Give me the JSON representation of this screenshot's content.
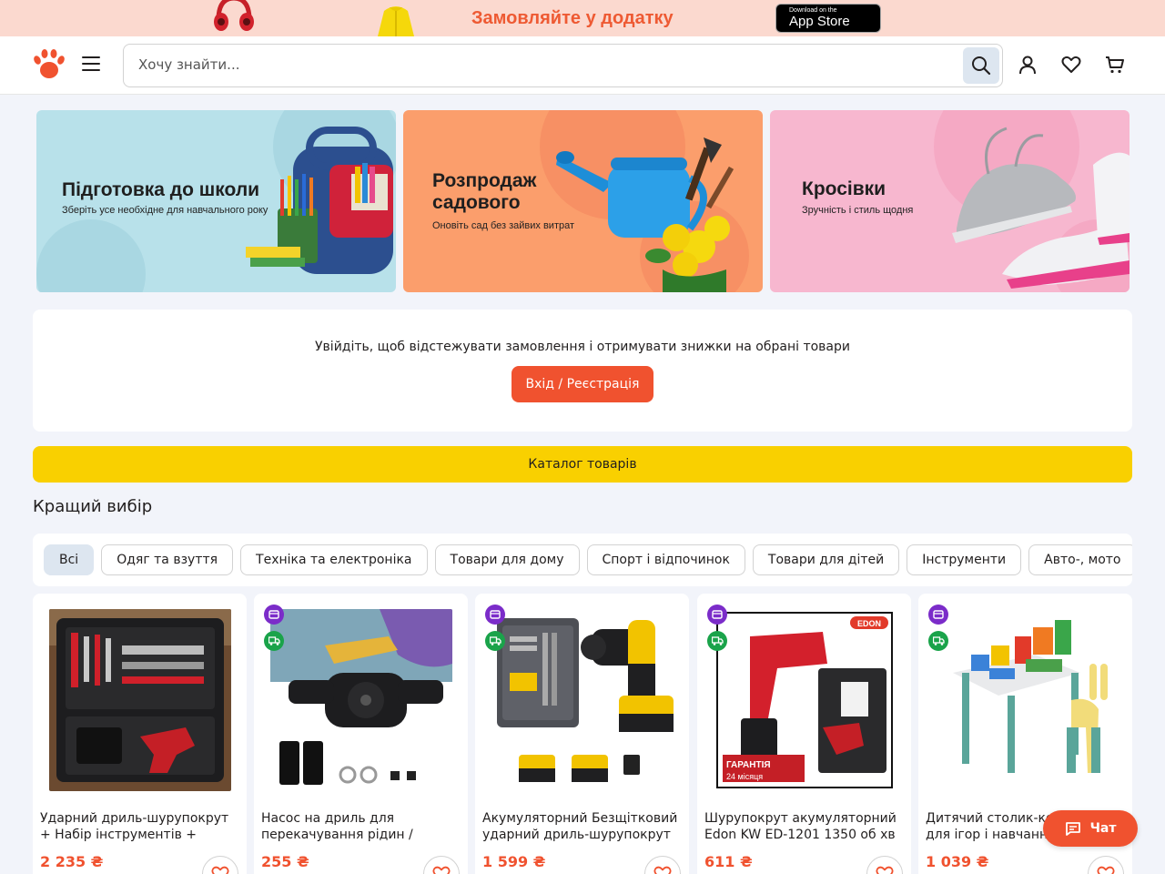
{
  "promo": {
    "text": "Замовляйте у додатку",
    "appstore_small": "Download on the",
    "appstore_big": "App Store"
  },
  "header": {
    "search_placeholder": "Хочу знайти...",
    "icons": [
      "logo-paw-icon",
      "menu-icon",
      "search-icon",
      "user-icon",
      "heart-icon",
      "cart-icon"
    ]
  },
  "banners": [
    {
      "title": "Підготовка до школи",
      "subtitle": "Зберіть усе необхідне для навчального року"
    },
    {
      "title": "Розпродаж садового",
      "subtitle": "Оновіть сад без зайвих витрат"
    },
    {
      "title": "Кросівки",
      "subtitle": "Зручність і стиль щодня"
    }
  ],
  "login": {
    "text": "Увійдіть, щоб відстежувати замовлення і отримувати знижки на обрані товари",
    "button": "Вхід / Реєстрація"
  },
  "catalog_button": "Каталог товарів",
  "section_title": "Кращий вибір",
  "chips": [
    {
      "label": "Всі",
      "active": true
    },
    {
      "label": "Одяг та взуття",
      "active": false
    },
    {
      "label": "Техніка та електроніка",
      "active": false
    },
    {
      "label": "Товари для дому",
      "active": false
    },
    {
      "label": "Спорт і відпочинок",
      "active": false
    },
    {
      "label": "Товари для дітей",
      "active": false
    },
    {
      "label": "Інструменти",
      "active": false
    },
    {
      "label": "Авто-, мото",
      "active": false
    }
  ],
  "products": [
    {
      "title": "Ударний дриль-шурупокрут + Набір інструментів +",
      "price": "2 235 ₴"
    },
    {
      "title": "Насос на дриль для перекачування рідин /",
      "price": "255 ₴"
    },
    {
      "title": "Акумуляторний Безщітковий ударний дриль-шурупокрут",
      "price": "1 599 ₴"
    },
    {
      "title": "Шурупокрут акумуляторний Edon KW ED-1201 1350 об хв",
      "price": "611 ₴"
    },
    {
      "title": "Дитячий столик-конструктор для ігор і навчання",
      "price": "1 039 ₴"
    }
  ],
  "product_image_texts": {
    "edon_brand": "EDON",
    "guarantee_line1": "ГАРАНТІЯ",
    "guarantee_line2": "24 місяця"
  },
  "chat_button": "Чат",
  "colors": {
    "accent": "#f0522f",
    "catalog_yellow": "#f9d000",
    "promo_bg": "#fbd9cf",
    "page_bg": "#f2f4fa",
    "badge_purple": "#7b2cc9",
    "badge_green": "#1aa34a"
  }
}
